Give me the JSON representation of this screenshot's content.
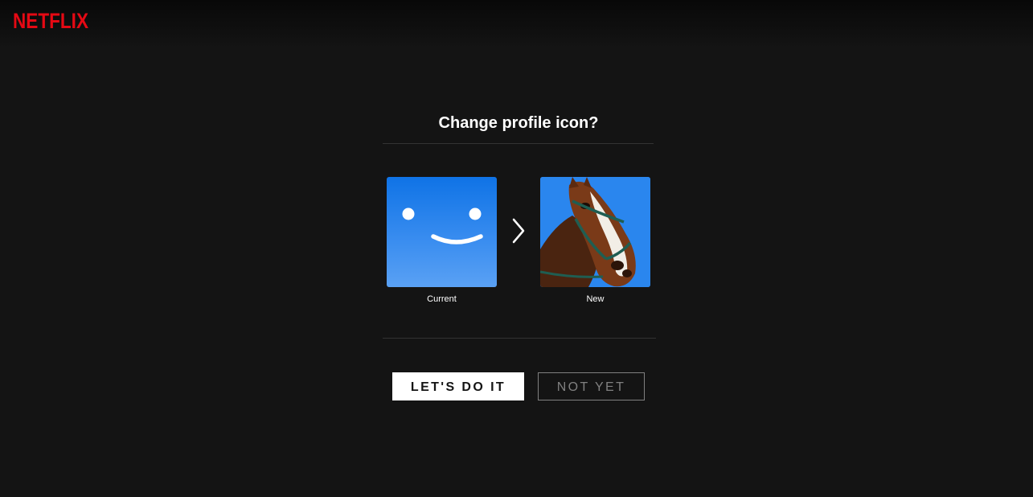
{
  "brand": {
    "logo_text": "NETFLIX",
    "logo_color": "#e50914"
  },
  "dialog": {
    "title": "Change profile icon?",
    "current_label": "Current",
    "new_label": "New",
    "current_icon": "smiley-face-icon",
    "new_icon": "horse-photo-icon",
    "arrow_icon": "chevron-right-icon"
  },
  "actions": {
    "confirm_label": "LET'S DO IT",
    "cancel_label": "NOT YET"
  },
  "colors": {
    "background": "#141414",
    "avatar_blue": "#0f73e6"
  }
}
